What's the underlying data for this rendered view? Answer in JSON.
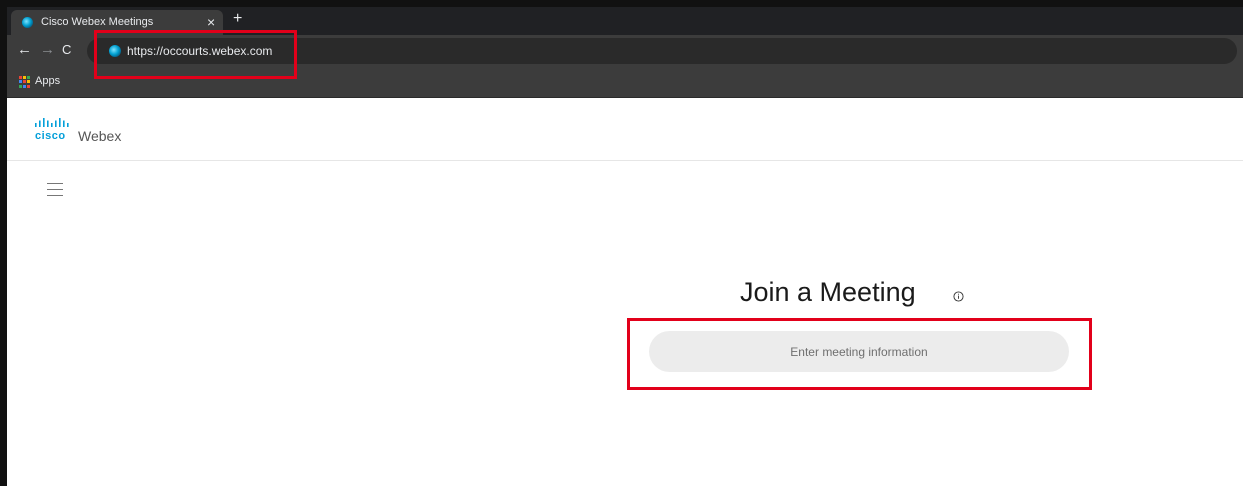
{
  "browser": {
    "tab": {
      "title": "Cisco Webex Meetings",
      "close_glyph": "×",
      "favicon": "webex-favicon-icon"
    },
    "new_tab_glyph": "+",
    "nav": {
      "back_glyph": "←",
      "forward_glyph": "→",
      "reload_glyph": "C"
    },
    "address_bar": {
      "url": "https://occourts.webex.com"
    },
    "bookmarks": {
      "apps_label": "Apps"
    }
  },
  "header": {
    "brand": "cisco",
    "product": "Webex",
    "brand_color": "#049fd9"
  },
  "menu": {
    "icon": "hamburger-menu-icon"
  },
  "join": {
    "title": "Join a Meeting",
    "input_placeholder": "Enter meeting information",
    "info_icon": "info-icon"
  },
  "annotations": {
    "highlight_color": "#e2001a"
  }
}
